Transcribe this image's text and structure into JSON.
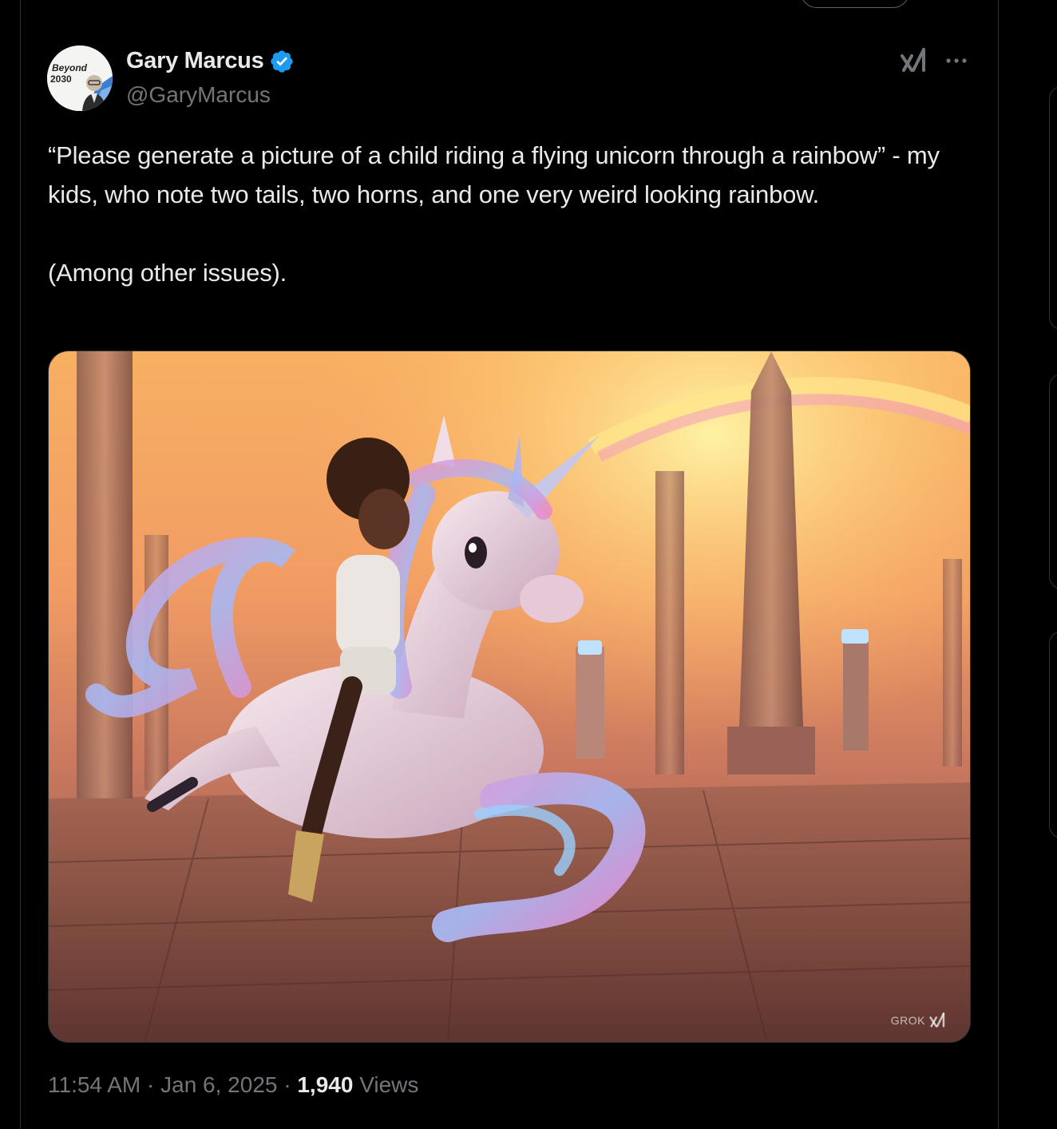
{
  "tweet": {
    "avatar_text": [
      "Beyond",
      "2030"
    ],
    "author_name": "Gary Marcus",
    "author_handle": "@GaryMarcus",
    "verified": true,
    "body_line1": "“Please generate a picture of a child riding a flying unicorn through a rainbow” - my kids, who note two tails, two horns, and one very weird looking rainbow.",
    "body_line2": "(Among other issues).",
    "media_watermark": "GROK",
    "time": "11:54 AM",
    "separator": "·",
    "date": "Jan 6, 2025",
    "views_count": "1,940",
    "views_label": "Views"
  },
  "icons": {
    "verified": "verified-badge-icon",
    "grok": "grok-icon",
    "more": "more-icon"
  },
  "colors": {
    "background": "#000000",
    "text_primary": "#e7e9ea",
    "text_secondary": "#71767b",
    "verified_blue": "#1d9bf0",
    "border": "#2f3336"
  }
}
